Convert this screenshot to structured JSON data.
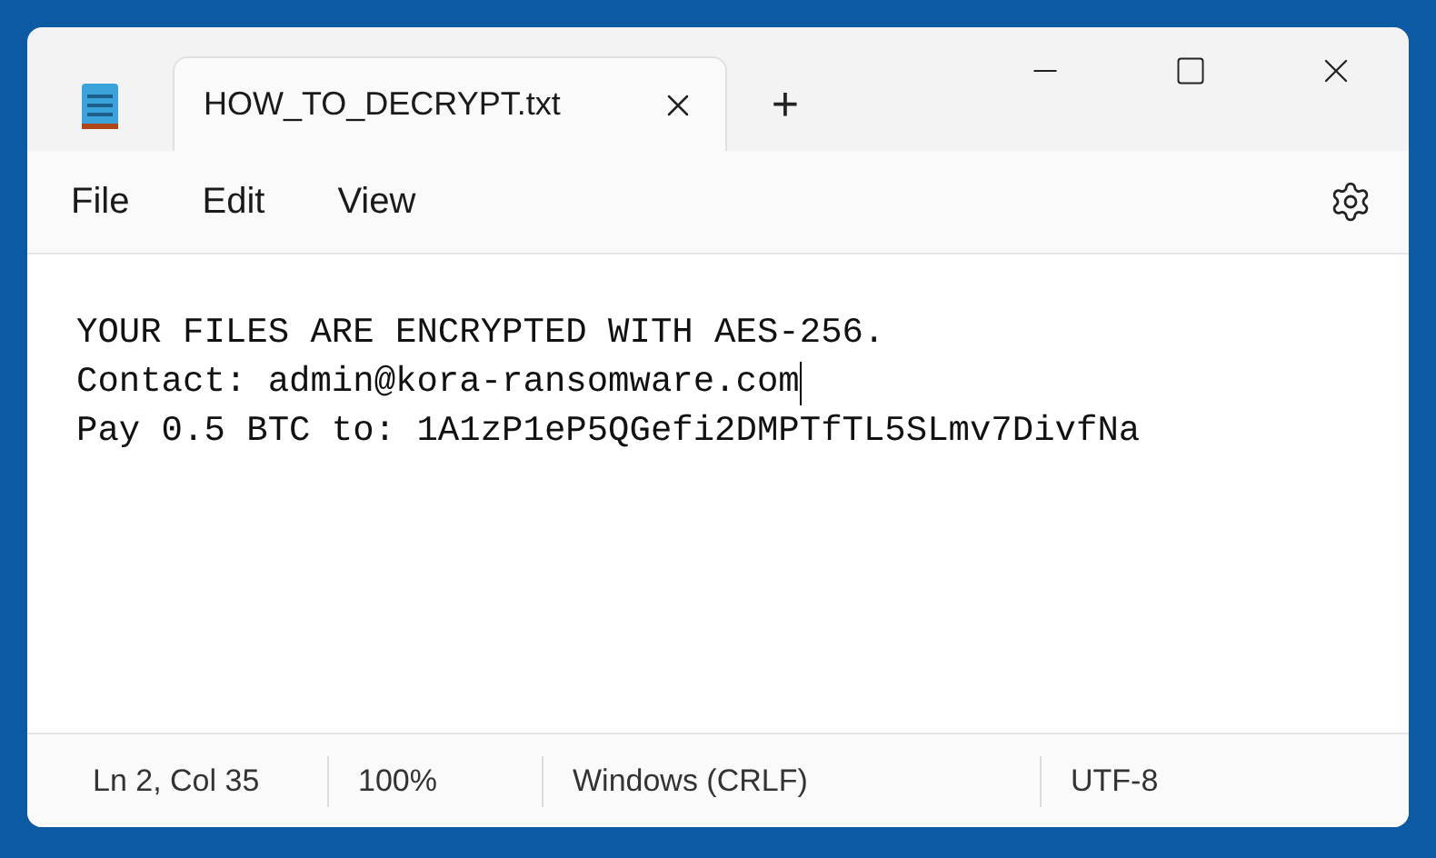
{
  "tabs": [
    {
      "label": "HOW_TO_DECRYPT.txt",
      "selected": true
    }
  ],
  "new_tab": "+",
  "menu": [
    "File",
    "Edit",
    "View"
  ],
  "editor": {
    "lines": [
      {
        "text": "YOUR FILES ARE ENCRYPTED WITH AES-256.",
        "caret": false
      },
      {
        "text": "Contact: admin@kora-ransomware.com",
        "caret": true
      },
      {
        "text": "Pay 0.5 BTC to: 1A1zP1eP5QGefi2DMPTfTL5SLmv7DivfNa",
        "caret": false
      }
    ]
  },
  "status_bar": [
    "Ln 2, Col 35",
    "100%",
    "Windows (CRLF)",
    "UTF-8"
  ]
}
